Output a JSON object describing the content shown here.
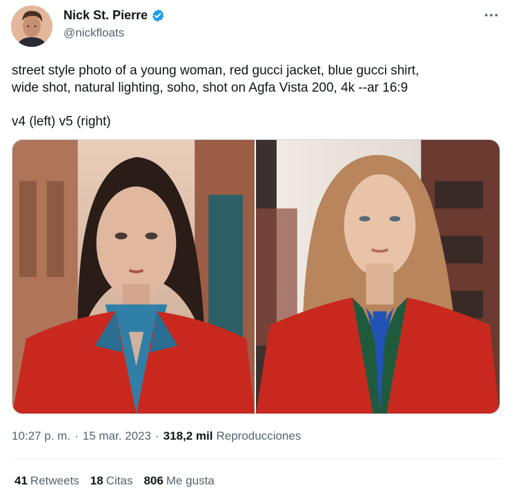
{
  "author": {
    "name": "Nick St. Pierre",
    "handle": "@nickfloats"
  },
  "tweet": {
    "line1": "street style photo of a young woman, red gucci jacket, blue gucci shirt,",
    "line2": "wide shot, natural lighting, soho, shot on Agfa Vista 200, 4k --ar 16:9",
    "line3": "v4 (left) v5 (right)"
  },
  "meta": {
    "time": "10:27 p. m.",
    "separator": "·",
    "date": "15 mar. 2023",
    "views_count": "318,2 mil",
    "views_label": "Reproducciones"
  },
  "stats": {
    "retweets_count": "41",
    "retweets_label": "Retweets",
    "quotes_count": "18",
    "quotes_label": "Citas",
    "likes_count": "806",
    "likes_label": "Me gusta"
  },
  "colors": {
    "verified": "#1d9bf0",
    "secondary_text": "#536471",
    "jacket_red": "#c8281e",
    "shirt_blue": "#2f7fa6"
  },
  "icons": [
    "verified-badge-icon",
    "more-options-icon"
  ]
}
